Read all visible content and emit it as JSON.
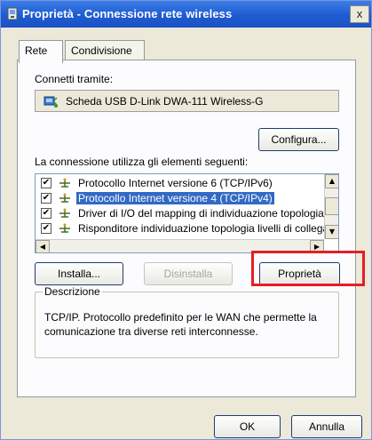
{
  "window": {
    "title": "Proprietà - Connessione rete wireless",
    "close_label": "x"
  },
  "tabs": [
    {
      "label": "Rete",
      "active": true
    },
    {
      "label": "Condivisione",
      "active": false
    }
  ],
  "connect_via": {
    "label": "Connetti tramite:",
    "adapter_name": "Scheda USB D-Link DWA-111 Wireless-G",
    "configure_label": "Configura..."
  },
  "items_section": {
    "label": "La connessione utilizza gli elementi seguenti:",
    "items": [
      {
        "label": "Protocollo Internet versione 6 (TCP/IPv6)",
        "checked": true,
        "selected": false
      },
      {
        "label": "Protocollo Internet versione 4 (TCP/IPv4)",
        "checked": true,
        "selected": true
      },
      {
        "label": "Driver di I/O del mapping di individuazione topologia liv",
        "checked": true,
        "selected": false
      },
      {
        "label": "Risponditore individuazione topologia livelli di collegame",
        "checked": true,
        "selected": false
      }
    ]
  },
  "actions": {
    "install_label": "Installa...",
    "uninstall_label": "Disinstalla",
    "properties_label": "Proprietà"
  },
  "description": {
    "legend": "Descrizione",
    "text": "TCP/IP. Protocollo predefinito per le WAN che permette la comunicazione tra diverse reti interconnesse."
  },
  "footer": {
    "ok_label": "OK",
    "cancel_label": "Annulla"
  },
  "colors": {
    "highlight": "#e51e26",
    "selection": "#316ac5",
    "titlebar": "#1e5bd1"
  },
  "icons": {
    "title": "network-connection-icon",
    "adapter": "network-adapter-icon",
    "protocol": "protocol-icon",
    "checkmark": "✔"
  }
}
